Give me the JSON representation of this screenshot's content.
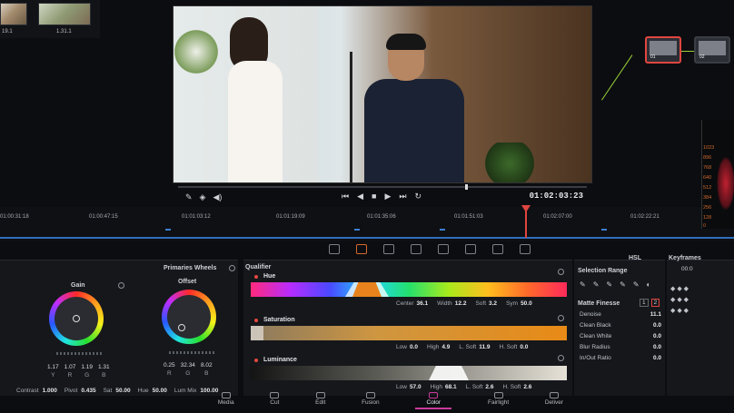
{
  "thumbnails": [
    {
      "label": "19.1"
    },
    {
      "label": "1.31.1"
    }
  ],
  "viewer": {
    "timecode": "01:02:03:23"
  },
  "timeline": {
    "ticks": [
      "01:00:31:18",
      "01:00:47:15",
      "01:01:03:12",
      "01:01:19:09",
      "01:01:35:06",
      "01:01:51:03",
      "01:02:07:00",
      "01:02:22:21"
    ]
  },
  "node_graph": {
    "node1_label": "01",
    "node2_label": "02"
  },
  "scope": {
    "values": [
      "1023",
      "896",
      "768",
      "640",
      "512",
      "384",
      "256",
      "128",
      "0"
    ]
  },
  "wheels_panel": {
    "mode": "Primaries Wheels",
    "gain": {
      "title": "Gain",
      "values": [
        "1.17",
        "1.07",
        "1.19",
        "1.31"
      ],
      "labels": [
        "Y",
        "R",
        "G",
        "B"
      ]
    },
    "offset": {
      "title": "Offset",
      "values": [
        "0.25",
        "32.34",
        "8.02"
      ],
      "labels": [
        "R",
        "G",
        "B"
      ]
    },
    "params": [
      {
        "label": "Contrast",
        "value": "1.000"
      },
      {
        "label": "Pivot",
        "value": "0.435"
      },
      {
        "label": "Sat",
        "value": "50.00"
      },
      {
        "label": "Hue",
        "value": "50.00"
      },
      {
        "label": "Lum Mix",
        "value": "100.00"
      }
    ]
  },
  "qualifier": {
    "title": "Qualifier",
    "hue": {
      "label": "Hue",
      "center": "36.1",
      "width": "12.2",
      "soft": "3.2",
      "sym": "50.0",
      "center_label": "Center",
      "width_label": "Width",
      "soft_label": "Soft",
      "sym_label": "Sym"
    },
    "saturation": {
      "label": "Saturation",
      "low": "0.0",
      "high": "4.9",
      "lsoft": "11.9",
      "hsoft": "0.0"
    },
    "luminance": {
      "label": "Luminance",
      "low": "57.0",
      "high": "68.1",
      "lsoft": "2.6",
      "hsoft": "2.6"
    },
    "low_label": "Low",
    "high_label": "High",
    "lsoft_label": "L. Soft",
    "hsoft_label": "H. Soft"
  },
  "selection": {
    "title": "Selection Range",
    "mode": "HSL",
    "matte_finesse": "Matte Finesse",
    "tab1": "1",
    "tab2": "2",
    "rows": [
      {
        "label": "Denoise",
        "value": "11.1"
      },
      {
        "label": "Clean Black",
        "value": "0.0"
      },
      {
        "label": "Clean White",
        "value": "0.0"
      },
      {
        "label": "Blur Radius",
        "value": "0.0"
      },
      {
        "label": "In/Out Ratio",
        "value": "0.0"
      }
    ]
  },
  "keyframes": {
    "title": "Keyframes",
    "timecode": "00:0"
  },
  "pages": [
    {
      "label": "Media",
      "active": false
    },
    {
      "label": "Cut",
      "active": false
    },
    {
      "label": "Edit",
      "active": false
    },
    {
      "label": "Fusion",
      "active": false
    },
    {
      "label": "Color",
      "active": true
    },
    {
      "label": "Fairlight",
      "active": false
    },
    {
      "label": "Deliver",
      "active": false
    }
  ],
  "accent_colors": {
    "qualifier_dot": "#e5483f",
    "color_page": "#c9399c",
    "playhead": "#e0453f",
    "node_link": "#9ad33a"
  }
}
